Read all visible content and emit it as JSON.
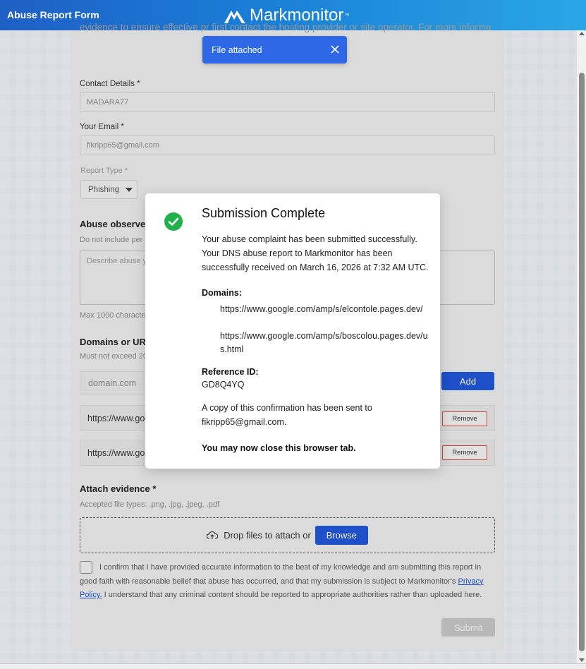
{
  "header": {
    "title": "Abuse Report Form",
    "brand": "Markmonitor",
    "trademark": "™"
  },
  "form": {
    "intro": "evidence to ensure effective pr                              first contact the hosting provider or site operator. For more informa",
    "contact_label": "Contact Details *",
    "contact_value": "MADARA77",
    "email_label": "Your Email *",
    "email_value": "fikripp65@gmail.com",
    "report_type_label": "Report Type *",
    "report_type_value": "Phishing",
    "abuse_heading": "Abuse observed",
    "abuse_hint": "Do not include per",
    "abuse_placeholder": "Describe abuse y",
    "abuse_limit": "Max 1000 characte",
    "domains_heading": "Domains or URL",
    "domains_hint": "Must not exceed 20",
    "domain_placeholder": "domain.com",
    "add_label": "Add",
    "urls": [
      "https://www.goo",
      "https://www.goo"
    ],
    "remove_label": "Remove",
    "attach_heading": "Attach evidence *",
    "attach_hint": "Accepted file types: .png, .jpg, .jpeg, .pdf",
    "drop_text": "Drop files to attach or",
    "browse_label": "Browse",
    "confirm_text_1": "I confirm that I have provided accurate information to the best of my knowledge and am submitting this report in good faith with reasonable belief that abuse has occurred, and that my submission is subject to Markmonitor's",
    "privacy_link": "Privacy Policy.",
    "confirm_text_2": "I understand that any criminal content should be reported to appropriate authorities rather than uploaded here.",
    "submit_label": "Submit"
  },
  "toast": {
    "text": "File attached"
  },
  "modal": {
    "title": "Submission Complete",
    "message": "Your abuse complaint has been submitted successfully. Your DNS abuse report to Markmonitor has been successfully received on March 16, 2026 at 7:32 AM UTC.",
    "domains_label": "Domains:",
    "domains": [
      "https://www.google.com/amp/s/elcontole.pages.dev/",
      "https://www.google.com/amp/s/boscolou.pages.dev/us.html"
    ],
    "ref_label": "Reference ID:",
    "ref_value": "GD8Q4YQ",
    "copy_text": "A copy of this confirmation has been sent to fikripp65@gmail.com.",
    "close_hint": "You may now close this browser tab."
  },
  "colors": {
    "primary": "#1f55d6",
    "success": "#1fb24a",
    "toast": "#2f68e6",
    "danger": "#d24a4a"
  },
  "icons": [
    "markmonitor-logo-icon",
    "close-icon",
    "check-circle-icon",
    "cloud-upload-icon",
    "chevron-down-icon"
  ]
}
